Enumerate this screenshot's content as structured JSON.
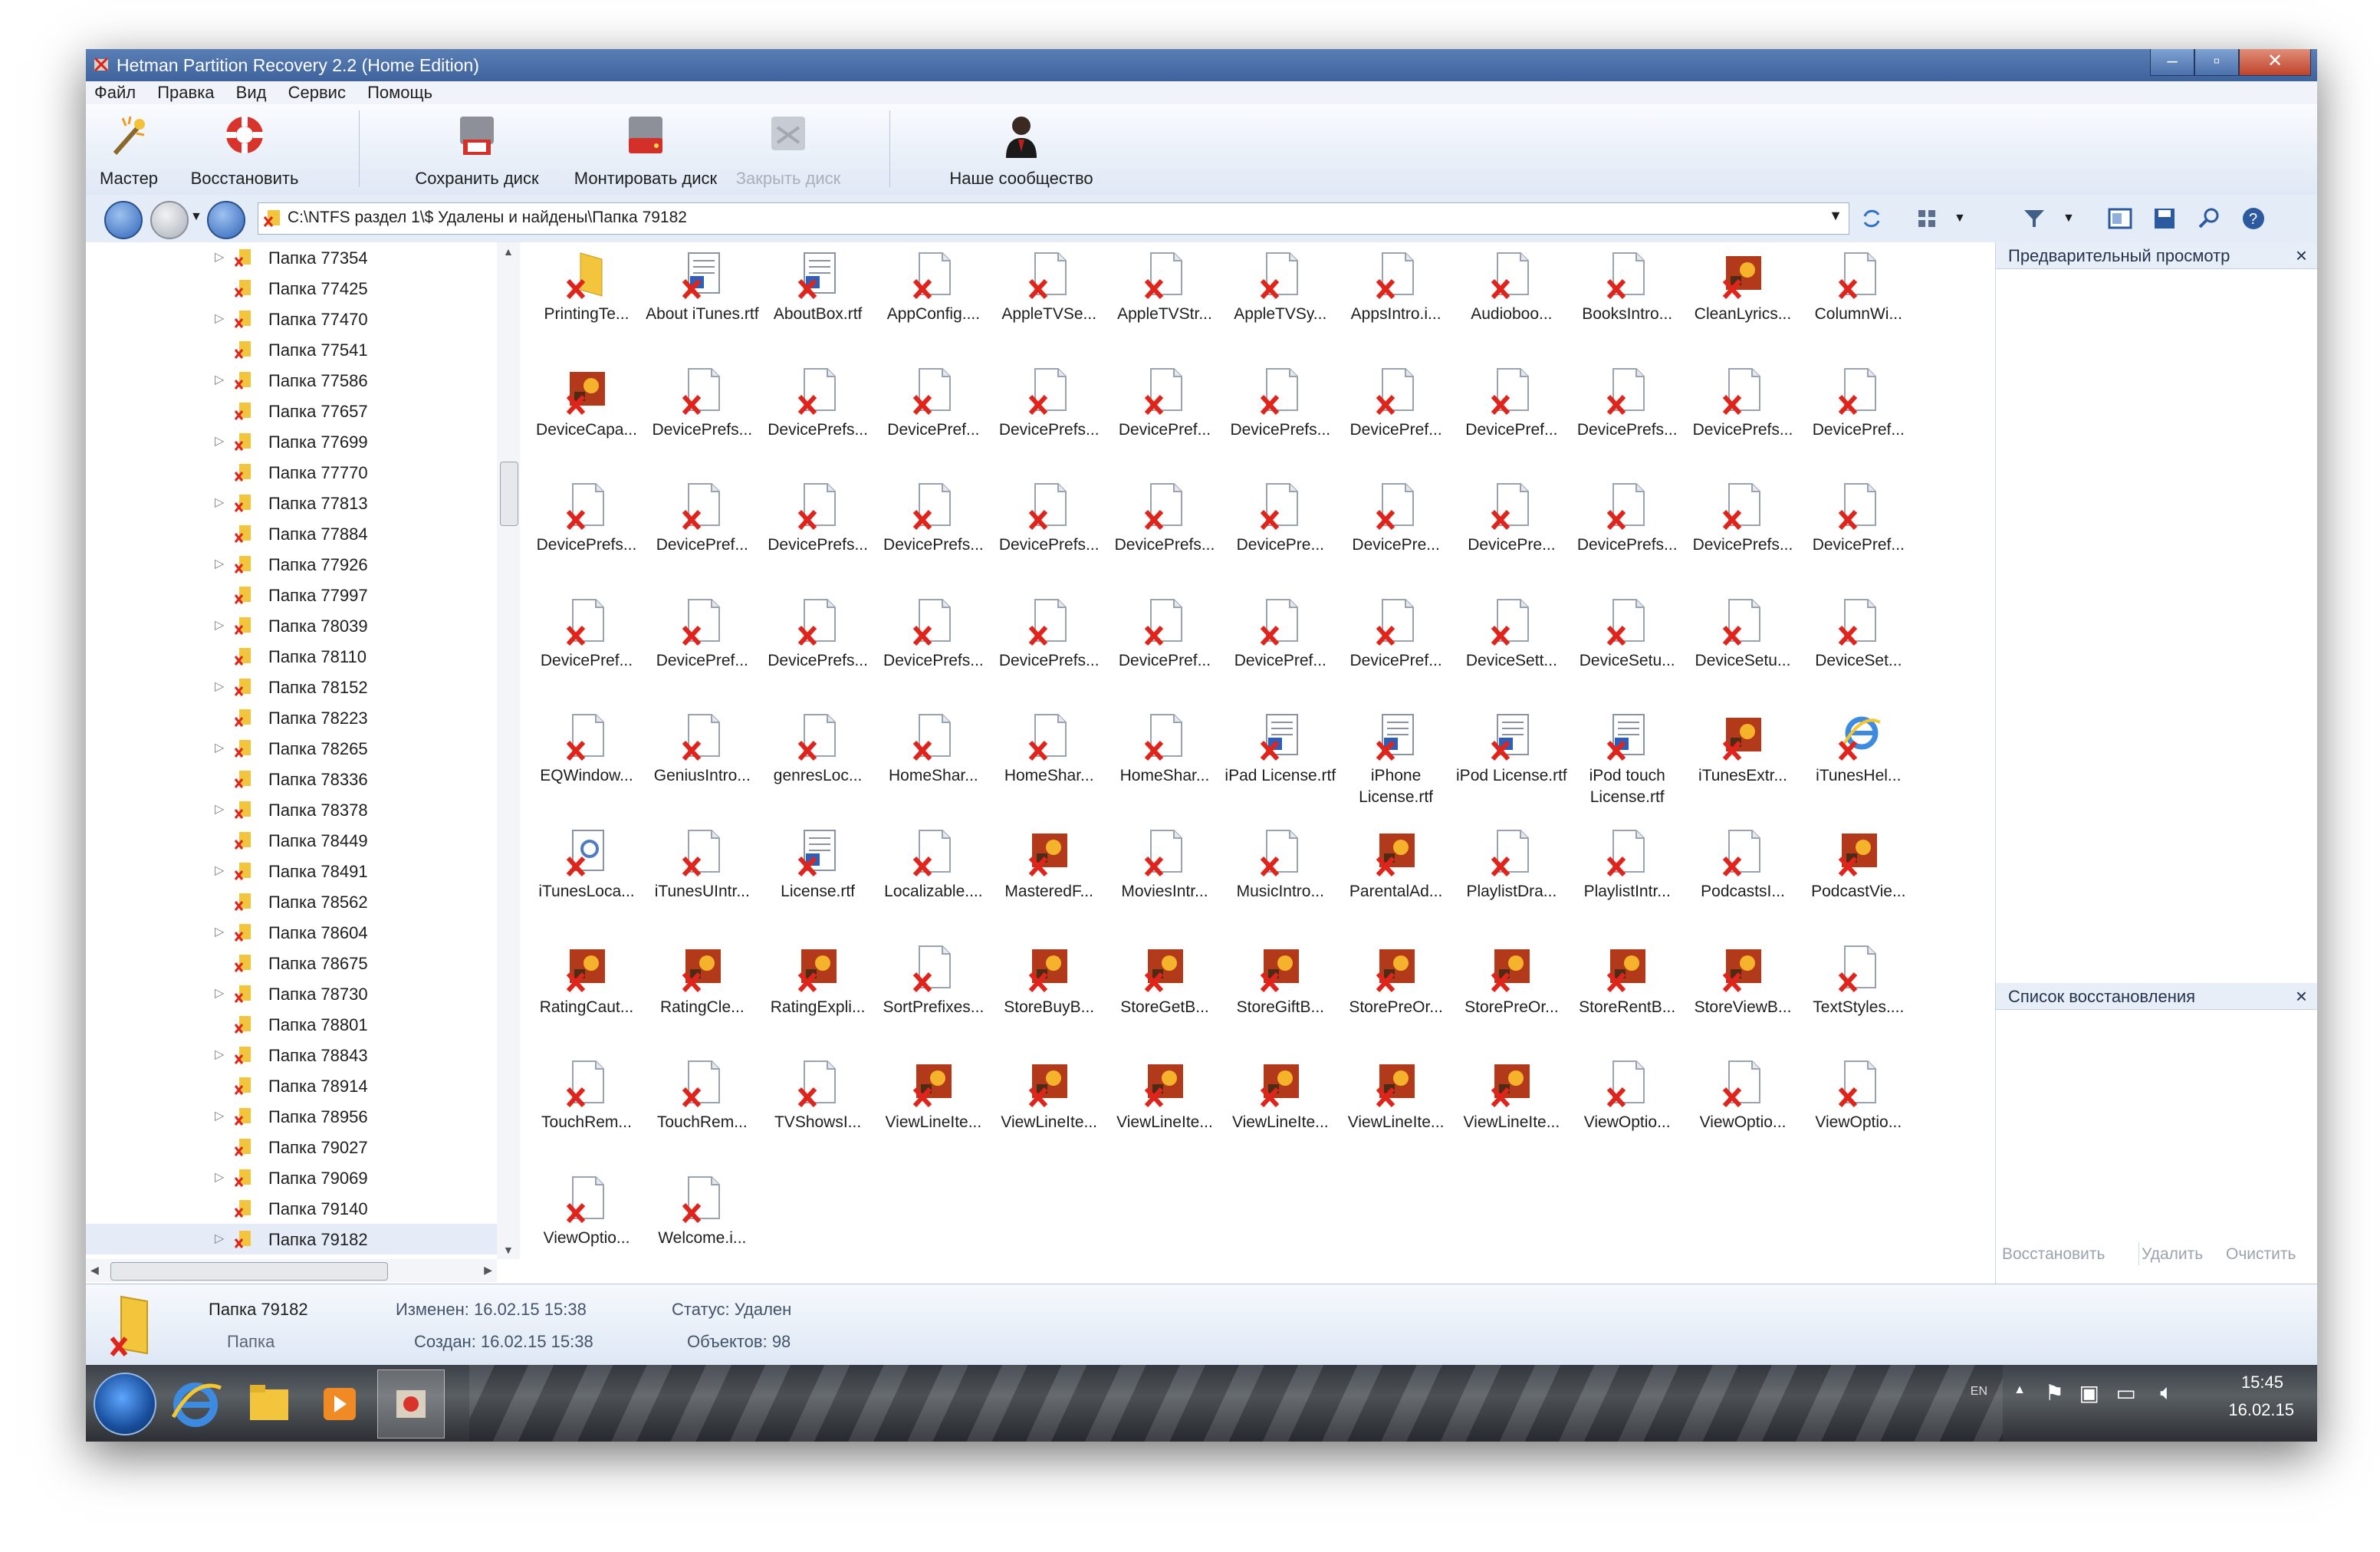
{
  "window": {
    "title": "Hetman Partition Recovery 2.2 (Home Edition)"
  },
  "menu": [
    "Файл",
    "Правка",
    "Вид",
    "Сервис",
    "Помощь"
  ],
  "toolbar": {
    "wizard": "Мастер",
    "restore": "Восстановить",
    "save_disk": "Сохранить диск",
    "mount_disk": "Монтировать диск",
    "close_disk": "Закрыть диск",
    "community": "Наше сообщество"
  },
  "address": {
    "path": "C:\\NTFS раздел 1\\$ Удалены и найдены\\Папка 79182"
  },
  "tree": [
    "Папка 77354",
    "Папка 77425",
    "Папка 77470",
    "Папка 77541",
    "Папка 77586",
    "Папка 77657",
    "Папка 77699",
    "Папка 77770",
    "Папка 77813",
    "Папка 77884",
    "Папка 77926",
    "Папка 77997",
    "Папка 78039",
    "Папка 78110",
    "Папка 78152",
    "Папка 78223",
    "Папка 78265",
    "Папка 78336",
    "Папка 78378",
    "Папка 78449",
    "Папка 78491",
    "Папка 78562",
    "Папка 78604",
    "Папка 78675",
    "Папка 78730",
    "Папка 78801",
    "Папка 78843",
    "Папка 78914",
    "Папка 78956",
    "Папка 79027",
    "Папка 79069",
    "Папка 79140",
    "Папка 79182"
  ],
  "tree_selected_index": 32,
  "files": [
    {
      "name": "PrintingTe...",
      "type": "folder"
    },
    {
      "name": "About iTunes.rtf",
      "type": "rtf"
    },
    {
      "name": "AboutBox.rtf",
      "type": "rtf"
    },
    {
      "name": "AppConfig....",
      "type": "doc"
    },
    {
      "name": "AppleTVSe...",
      "type": "doc"
    },
    {
      "name": "AppleTVStr...",
      "type": "doc"
    },
    {
      "name": "AppleTVSy...",
      "type": "doc"
    },
    {
      "name": "AppsIntro.i...",
      "type": "doc"
    },
    {
      "name": "Audioboo...",
      "type": "doc"
    },
    {
      "name": "BooksIntro...",
      "type": "doc"
    },
    {
      "name": "CleanLyrics...",
      "type": "img"
    },
    {
      "name": "ColumnWi...",
      "type": "doc"
    },
    {
      "name": "DeviceCapa...",
      "type": "img"
    },
    {
      "name": "DevicePrefs...",
      "type": "doc"
    },
    {
      "name": "DevicePrefs...",
      "type": "doc"
    },
    {
      "name": "DevicePref...",
      "type": "doc"
    },
    {
      "name": "DevicePrefs...",
      "type": "doc"
    },
    {
      "name": "DevicePref...",
      "type": "doc"
    },
    {
      "name": "DevicePrefs...",
      "type": "doc"
    },
    {
      "name": "DevicePref...",
      "type": "doc"
    },
    {
      "name": "DevicePref...",
      "type": "doc"
    },
    {
      "name": "DevicePrefs...",
      "type": "doc"
    },
    {
      "name": "DevicePrefs...",
      "type": "doc"
    },
    {
      "name": "DevicePref...",
      "type": "doc"
    },
    {
      "name": "DevicePrefs...",
      "type": "doc"
    },
    {
      "name": "DevicePref...",
      "type": "doc"
    },
    {
      "name": "DevicePrefs...",
      "type": "doc"
    },
    {
      "name": "DevicePrefs...",
      "type": "doc"
    },
    {
      "name": "DevicePrefs...",
      "type": "doc"
    },
    {
      "name": "DevicePrefs...",
      "type": "doc"
    },
    {
      "name": "DevicePre...",
      "type": "doc"
    },
    {
      "name": "DevicePre...",
      "type": "doc"
    },
    {
      "name": "DevicePre...",
      "type": "doc"
    },
    {
      "name": "DevicePrefs...",
      "type": "doc"
    },
    {
      "name": "DevicePrefs...",
      "type": "doc"
    },
    {
      "name": "DevicePref...",
      "type": "doc"
    },
    {
      "name": "DevicePref...",
      "type": "doc"
    },
    {
      "name": "DevicePref...",
      "type": "doc"
    },
    {
      "name": "DevicePrefs...",
      "type": "doc"
    },
    {
      "name": "DevicePrefs...",
      "type": "doc"
    },
    {
      "name": "DevicePrefs...",
      "type": "doc"
    },
    {
      "name": "DevicePref...",
      "type": "doc"
    },
    {
      "name": "DevicePref...",
      "type": "doc"
    },
    {
      "name": "DevicePref...",
      "type": "doc"
    },
    {
      "name": "DeviceSett...",
      "type": "doc"
    },
    {
      "name": "DeviceSetu...",
      "type": "doc"
    },
    {
      "name": "DeviceSetu...",
      "type": "doc"
    },
    {
      "name": "DeviceSet...",
      "type": "doc"
    },
    {
      "name": "EQWindow...",
      "type": "doc"
    },
    {
      "name": "GeniusIntro...",
      "type": "doc"
    },
    {
      "name": "genresLoc...",
      "type": "doc"
    },
    {
      "name": "HomeShar...",
      "type": "doc"
    },
    {
      "name": "HomeShar...",
      "type": "doc"
    },
    {
      "name": "HomeShar...",
      "type": "doc"
    },
    {
      "name": "iPad License.rtf",
      "type": "rtf"
    },
    {
      "name": "iPhone License.rtf",
      "type": "rtf"
    },
    {
      "name": "iPod License.rtf",
      "type": "rtf"
    },
    {
      "name": "iPod touch License.rtf",
      "type": "rtf"
    },
    {
      "name": "iTunesExtr...",
      "type": "img"
    },
    {
      "name": "iTunesHel...",
      "type": "ie"
    },
    {
      "name": "iTunesLoca...",
      "type": "cfg"
    },
    {
      "name": "iTunesUIntr...",
      "type": "doc"
    },
    {
      "name": "License.rtf",
      "type": "rtf"
    },
    {
      "name": "Localizable....",
      "type": "doc"
    },
    {
      "name": "MasteredF...",
      "type": "img"
    },
    {
      "name": "MoviesIntr...",
      "type": "doc"
    },
    {
      "name": "MusicIntro...",
      "type": "doc"
    },
    {
      "name": "ParentalAd...",
      "type": "img"
    },
    {
      "name": "PlaylistDra...",
      "type": "doc"
    },
    {
      "name": "PlaylistIntr...",
      "type": "doc"
    },
    {
      "name": "PodcastsI...",
      "type": "doc"
    },
    {
      "name": "PodcastVie...",
      "type": "img"
    },
    {
      "name": "RatingCaut...",
      "type": "img"
    },
    {
      "name": "RatingCle...",
      "type": "img"
    },
    {
      "name": "RatingExpli...",
      "type": "img"
    },
    {
      "name": "SortPrefixes...",
      "type": "doc"
    },
    {
      "name": "StoreBuyB...",
      "type": "img"
    },
    {
      "name": "StoreGetB...",
      "type": "img"
    },
    {
      "name": "StoreGiftB...",
      "type": "img"
    },
    {
      "name": "StorePreOr...",
      "type": "img"
    },
    {
      "name": "StorePreOr...",
      "type": "img"
    },
    {
      "name": "StoreRentB...",
      "type": "img"
    },
    {
      "name": "StoreViewB...",
      "type": "img"
    },
    {
      "name": "TextStyles....",
      "type": "doc"
    },
    {
      "name": "TouchRem...",
      "type": "doc"
    },
    {
      "name": "TouchRem...",
      "type": "doc"
    },
    {
      "name": "TVShowsI...",
      "type": "doc"
    },
    {
      "name": "ViewLineIte...",
      "type": "img"
    },
    {
      "name": "ViewLineIte...",
      "type": "img"
    },
    {
      "name": "ViewLineIte...",
      "type": "img"
    },
    {
      "name": "ViewLineIte...",
      "type": "img"
    },
    {
      "name": "ViewLineIte...",
      "type": "img"
    },
    {
      "name": "ViewLineIte...",
      "type": "img"
    },
    {
      "name": "ViewOptio...",
      "type": "doc"
    },
    {
      "name": "ViewOptio...",
      "type": "doc"
    },
    {
      "name": "ViewOptio...",
      "type": "doc"
    },
    {
      "name": "ViewOptio...",
      "type": "doc"
    },
    {
      "name": "Welcome.i...",
      "type": "doc"
    }
  ],
  "preview_panel": {
    "title": "Предварительный просмотр"
  },
  "restore_list": {
    "title": "Список восстановления",
    "restore": "Восстановить",
    "delete": "Удалить",
    "clear": "Очистить"
  },
  "status": {
    "name": "Папка 79182",
    "type": "Папка",
    "modified": "Изменен: 16.02.15 15:38",
    "created": "Создан: 16.02.15 15:38",
    "state": "Статус: Удален",
    "objects": "Объектов: 98"
  },
  "tray": {
    "lang": "EN",
    "time": "15:45",
    "date": "16.02.15"
  },
  "colors": {
    "titlebar": "#4a6fa8",
    "deleted_x": "#e0241b",
    "folder": "#f2c53c"
  }
}
